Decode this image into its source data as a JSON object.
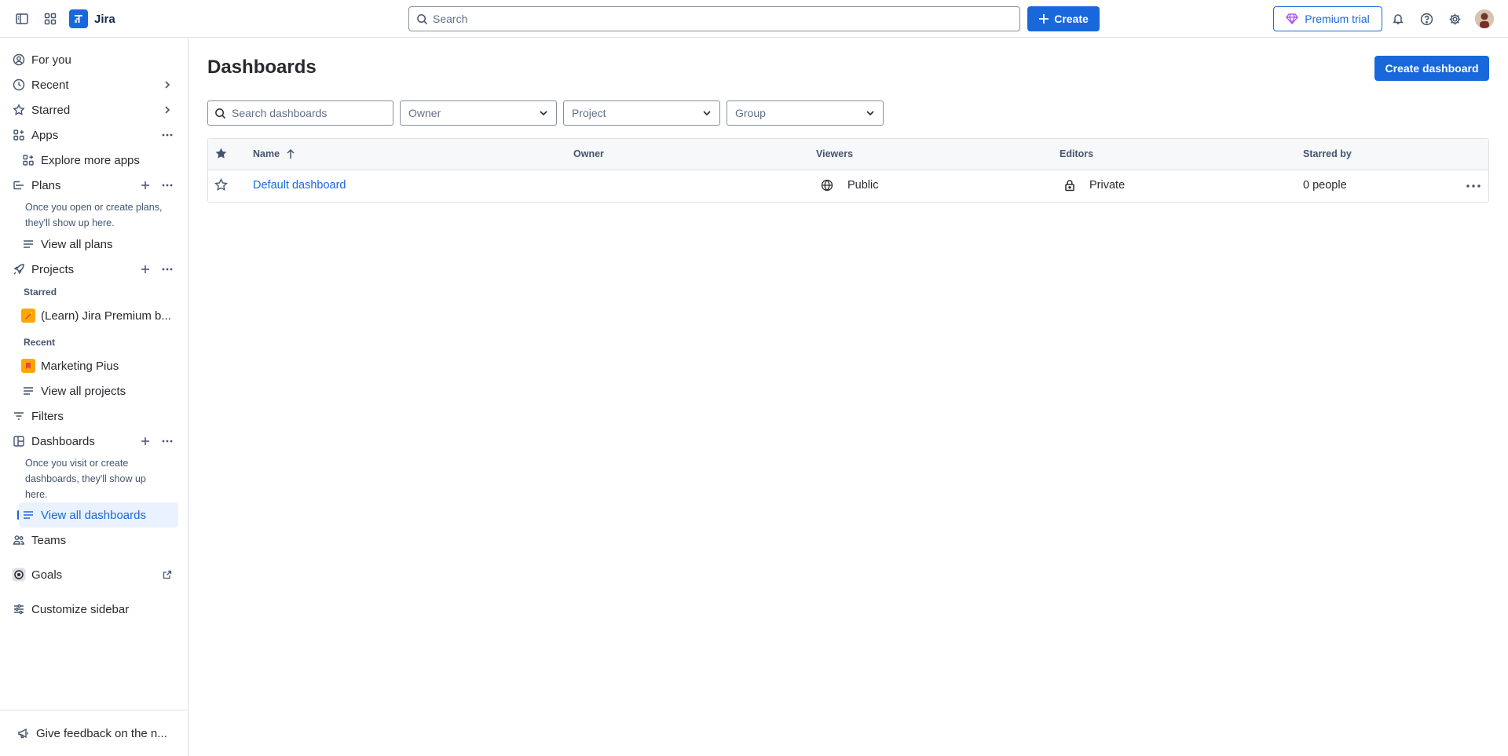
{
  "topbar": {
    "product_name": "Jira",
    "search_placeholder": "Search",
    "create_label": "Create",
    "premium_label": "Premium trial"
  },
  "sidebar": {
    "for_you": "For you",
    "recent": "Recent",
    "starred": "Starred",
    "apps": "Apps",
    "explore_apps": "Explore more apps",
    "plans": "Plans",
    "plans_note": "Once you open or create plans, they'll show up here.",
    "view_all_plans": "View all plans",
    "projects": "Projects",
    "projects_starred_heading": "Starred",
    "starred_project": "(Learn) Jira Premium b...",
    "projects_recent_heading": "Recent",
    "recent_project": "Marketing Pius",
    "view_all_projects": "View all projects",
    "filters": "Filters",
    "dashboards": "Dashboards",
    "dashboards_note": "Once you visit or create dashboards, they'll show up here.",
    "view_all_dashboards": "View all dashboards",
    "teams": "Teams",
    "goals": "Goals",
    "customize": "Customize sidebar",
    "feedback": "Give feedback on the n..."
  },
  "main": {
    "title": "Dashboards",
    "create_dashboard": "Create dashboard",
    "search_placeholder": "Search dashboards",
    "filters": {
      "owner": "Owner",
      "project": "Project",
      "group": "Group"
    },
    "table": {
      "headers": {
        "name": "Name",
        "owner": "Owner",
        "viewers": "Viewers",
        "editors": "Editors",
        "starred_by": "Starred by"
      },
      "rows": [
        {
          "name": "Default dashboard",
          "owner": "",
          "viewers": "Public",
          "editors": "Private",
          "starred_by": "0 people"
        }
      ]
    }
  },
  "colors": {
    "brand": "#1868db",
    "selected_bg": "#e9f2fe",
    "border": "#dcdfe4",
    "text": "#292a2e",
    "subtle_text": "#44546f"
  },
  "icons": {
    "sidebar_toggle": "sidebar-toggle-icon",
    "app_switcher": "app-switcher-icon",
    "notifications": "bell-icon",
    "help": "help-icon",
    "settings": "gear-icon"
  }
}
